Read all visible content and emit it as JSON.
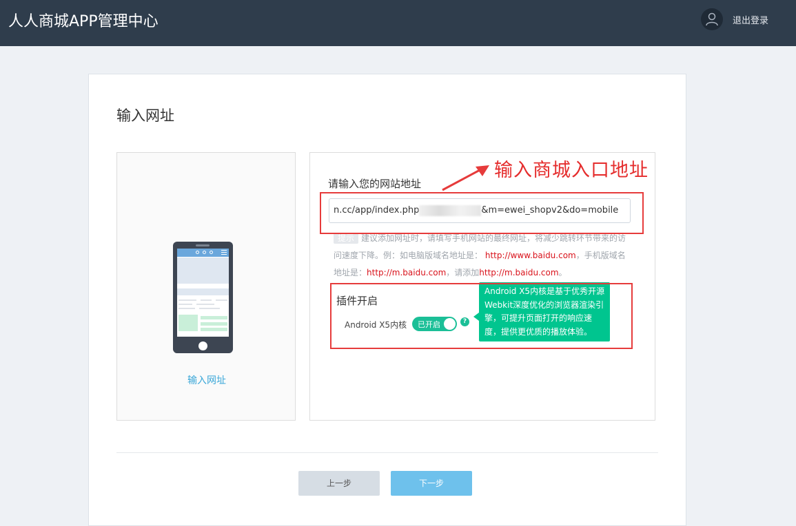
{
  "header": {
    "brand": "人人商城APP管理中心",
    "logout": "退出登录",
    "avatar_icon": "user-icon"
  },
  "page": {
    "title": "输入网址"
  },
  "left_panel": {
    "caption": "输入网址",
    "illustration_icon": "phone-icon"
  },
  "form": {
    "url_label": "请输入您的网站地址",
    "url_value_start": "n.cc/app/index.php",
    "url_value_end": "&m=ewei_shopv2&do=mobile",
    "hint_tag": "提示",
    "hint_text": "建议添加网址时，请填写手机网站的最终网址，将减少跳转环节带来的访问速度下降。例：如电脑版域名地址是：",
    "hint_link1": "http://www.baidu.com",
    "hint_mid": "，手机版域名地址是：",
    "hint_link2": "http://m.baidu.com",
    "hint_mid2": "，请添加",
    "hint_link3": "http://m.baidu.com",
    "hint_end": "。"
  },
  "plugin": {
    "title": "插件开启",
    "x5_label": "Android X5内核",
    "switch_text": "已开启",
    "help_glyph": "?",
    "tooltip": "Android X5内核是基于优秀开源Webkit深度优化的浏览器渲染引擎，可提升页面打开的响应速度，提供更优质的播放体验。"
  },
  "annotation": {
    "text": "输入商城入口地址",
    "color": "#e52d2d"
  },
  "footer": {
    "prev_label": "上一步",
    "next_label": "下一步"
  },
  "colors": {
    "header_bg": "#2f3d4c",
    "accent": "#1bbf97",
    "next_button": "#6ec1ec",
    "link_red": "#d9121b"
  }
}
